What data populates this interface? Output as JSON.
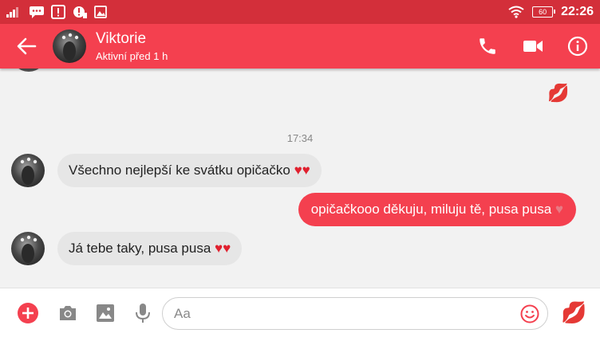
{
  "status_bar": {
    "time": "22:26",
    "battery_level": "60",
    "icons": [
      "signal-icon",
      "chat-notification-icon",
      "alert-icon",
      "app-notification-icon",
      "image-notification-icon",
      "wifi-icon",
      "battery-icon"
    ]
  },
  "header": {
    "contact_name": "Viktorie",
    "status": "Aktivní před 1 h",
    "icons": [
      "back-arrow-icon",
      "phone-icon",
      "video-camera-icon",
      "info-icon"
    ]
  },
  "conversation": {
    "top_reaction": "💋",
    "timestamp": "17:34",
    "messages": [
      {
        "direction": "incoming",
        "text": "Všechno nejlepší ke svátku opičačko",
        "hearts": "♥♥"
      },
      {
        "direction": "outgoing",
        "text": "opičačkooo děkuju, miluju tě, pusa pusa",
        "hearts": "♥"
      },
      {
        "direction": "incoming",
        "text": "Já tebe taky, pusa pusa",
        "hearts": "♥♥"
      }
    ]
  },
  "composer": {
    "placeholder": "Aa",
    "value": "",
    "quick_reaction": "💋",
    "icons": [
      "plus-icon",
      "camera-icon",
      "gallery-icon",
      "microphone-icon",
      "emoji-icon"
    ]
  },
  "colors": {
    "status_bar": "#d32f3a",
    "accent": "#f4404f",
    "incoming_bubble": "#e6e6e6",
    "background": "#f2f2f2"
  }
}
